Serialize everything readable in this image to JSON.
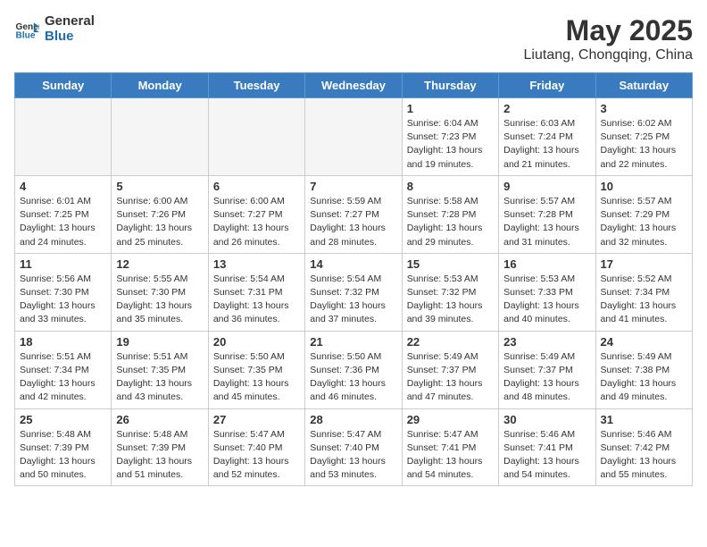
{
  "header": {
    "logo_line1": "General",
    "logo_line2": "Blue",
    "month": "May 2025",
    "location": "Liutang, Chongqing, China"
  },
  "weekdays": [
    "Sunday",
    "Monday",
    "Tuesday",
    "Wednesday",
    "Thursday",
    "Friday",
    "Saturday"
  ],
  "weeks": [
    [
      {
        "day": "",
        "info": ""
      },
      {
        "day": "",
        "info": ""
      },
      {
        "day": "",
        "info": ""
      },
      {
        "day": "",
        "info": ""
      },
      {
        "day": "1",
        "info": "Sunrise: 6:04 AM\nSunset: 7:23 PM\nDaylight: 13 hours\nand 19 minutes."
      },
      {
        "day": "2",
        "info": "Sunrise: 6:03 AM\nSunset: 7:24 PM\nDaylight: 13 hours\nand 21 minutes."
      },
      {
        "day": "3",
        "info": "Sunrise: 6:02 AM\nSunset: 7:25 PM\nDaylight: 13 hours\nand 22 minutes."
      }
    ],
    [
      {
        "day": "4",
        "info": "Sunrise: 6:01 AM\nSunset: 7:25 PM\nDaylight: 13 hours\nand 24 minutes."
      },
      {
        "day": "5",
        "info": "Sunrise: 6:00 AM\nSunset: 7:26 PM\nDaylight: 13 hours\nand 25 minutes."
      },
      {
        "day": "6",
        "info": "Sunrise: 6:00 AM\nSunset: 7:27 PM\nDaylight: 13 hours\nand 26 minutes."
      },
      {
        "day": "7",
        "info": "Sunrise: 5:59 AM\nSunset: 7:27 PM\nDaylight: 13 hours\nand 28 minutes."
      },
      {
        "day": "8",
        "info": "Sunrise: 5:58 AM\nSunset: 7:28 PM\nDaylight: 13 hours\nand 29 minutes."
      },
      {
        "day": "9",
        "info": "Sunrise: 5:57 AM\nSunset: 7:28 PM\nDaylight: 13 hours\nand 31 minutes."
      },
      {
        "day": "10",
        "info": "Sunrise: 5:57 AM\nSunset: 7:29 PM\nDaylight: 13 hours\nand 32 minutes."
      }
    ],
    [
      {
        "day": "11",
        "info": "Sunrise: 5:56 AM\nSunset: 7:30 PM\nDaylight: 13 hours\nand 33 minutes."
      },
      {
        "day": "12",
        "info": "Sunrise: 5:55 AM\nSunset: 7:30 PM\nDaylight: 13 hours\nand 35 minutes."
      },
      {
        "day": "13",
        "info": "Sunrise: 5:54 AM\nSunset: 7:31 PM\nDaylight: 13 hours\nand 36 minutes."
      },
      {
        "day": "14",
        "info": "Sunrise: 5:54 AM\nSunset: 7:32 PM\nDaylight: 13 hours\nand 37 minutes."
      },
      {
        "day": "15",
        "info": "Sunrise: 5:53 AM\nSunset: 7:32 PM\nDaylight: 13 hours\nand 39 minutes."
      },
      {
        "day": "16",
        "info": "Sunrise: 5:53 AM\nSunset: 7:33 PM\nDaylight: 13 hours\nand 40 minutes."
      },
      {
        "day": "17",
        "info": "Sunrise: 5:52 AM\nSunset: 7:34 PM\nDaylight: 13 hours\nand 41 minutes."
      }
    ],
    [
      {
        "day": "18",
        "info": "Sunrise: 5:51 AM\nSunset: 7:34 PM\nDaylight: 13 hours\nand 42 minutes."
      },
      {
        "day": "19",
        "info": "Sunrise: 5:51 AM\nSunset: 7:35 PM\nDaylight: 13 hours\nand 43 minutes."
      },
      {
        "day": "20",
        "info": "Sunrise: 5:50 AM\nSunset: 7:35 PM\nDaylight: 13 hours\nand 45 minutes."
      },
      {
        "day": "21",
        "info": "Sunrise: 5:50 AM\nSunset: 7:36 PM\nDaylight: 13 hours\nand 46 minutes."
      },
      {
        "day": "22",
        "info": "Sunrise: 5:49 AM\nSunset: 7:37 PM\nDaylight: 13 hours\nand 47 minutes."
      },
      {
        "day": "23",
        "info": "Sunrise: 5:49 AM\nSunset: 7:37 PM\nDaylight: 13 hours\nand 48 minutes."
      },
      {
        "day": "24",
        "info": "Sunrise: 5:49 AM\nSunset: 7:38 PM\nDaylight: 13 hours\nand 49 minutes."
      }
    ],
    [
      {
        "day": "25",
        "info": "Sunrise: 5:48 AM\nSunset: 7:39 PM\nDaylight: 13 hours\nand 50 minutes."
      },
      {
        "day": "26",
        "info": "Sunrise: 5:48 AM\nSunset: 7:39 PM\nDaylight: 13 hours\nand 51 minutes."
      },
      {
        "day": "27",
        "info": "Sunrise: 5:47 AM\nSunset: 7:40 PM\nDaylight: 13 hours\nand 52 minutes."
      },
      {
        "day": "28",
        "info": "Sunrise: 5:47 AM\nSunset: 7:40 PM\nDaylight: 13 hours\nand 53 minutes."
      },
      {
        "day": "29",
        "info": "Sunrise: 5:47 AM\nSunset: 7:41 PM\nDaylight: 13 hours\nand 54 minutes."
      },
      {
        "day": "30",
        "info": "Sunrise: 5:46 AM\nSunset: 7:41 PM\nDaylight: 13 hours\nand 54 minutes."
      },
      {
        "day": "31",
        "info": "Sunrise: 5:46 AM\nSunset: 7:42 PM\nDaylight: 13 hours\nand 55 minutes."
      }
    ]
  ]
}
